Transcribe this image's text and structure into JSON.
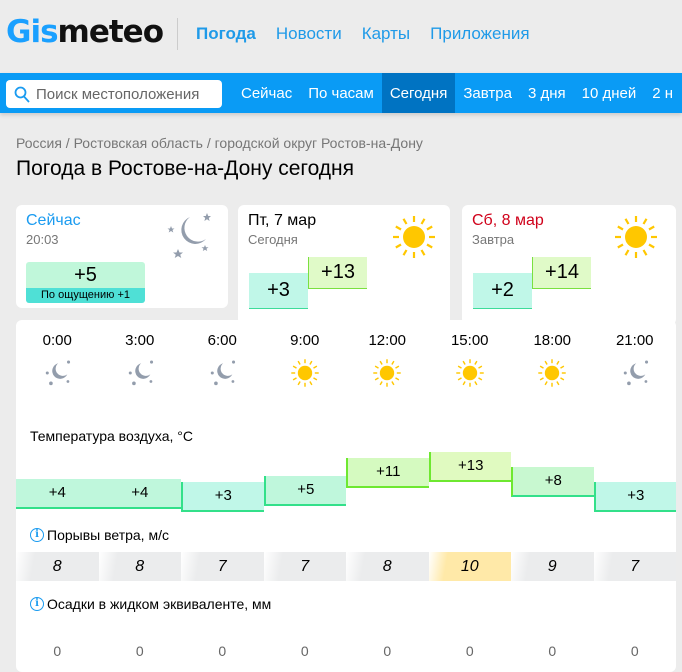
{
  "header": {
    "logo_a": "Gis",
    "logo_b": "meteo",
    "nav": [
      "Погода",
      "Новости",
      "Карты",
      "Приложения"
    ]
  },
  "search": {
    "placeholder": "Поиск местоположения"
  },
  "tabs": [
    "Сейчас",
    "По часам",
    "Сегодня",
    "Завтра",
    "3 дня",
    "10 дней",
    "2 н"
  ],
  "active_tab": 2,
  "breadcrumb": "Россия / Ростовская область / городской округ Ростов-на-Дону",
  "title": "Погода в Ростове-на-Дону сегодня",
  "now": {
    "label": "Сейчас",
    "time": "20:03",
    "temp": "+5",
    "feels": "По ощущению +1",
    "icon": "moon-stars-icon"
  },
  "today": {
    "date": "Пт, 7 мар",
    "label": "Сегодня",
    "min": "+3",
    "max": "+13",
    "icon": "sun-icon"
  },
  "tomorrow": {
    "date": "Сб, 8 мар",
    "label": "Завтра",
    "min": "+2",
    "max": "+14",
    "icon": "sun-icon"
  },
  "colors": {
    "accent": "#0a9bf5",
    "active_tab": "#0073c2",
    "weekend": "#d0021b"
  },
  "hourly": {
    "times": [
      "0:00",
      "3:00",
      "6:00",
      "9:00",
      "12:00",
      "15:00",
      "18:00",
      "21:00"
    ],
    "icons": [
      "moon",
      "moon",
      "moon",
      "sun",
      "sun",
      "sun",
      "sun",
      "moon"
    ],
    "temp_label": "Температура воздуха, °C",
    "temps": [
      "+4",
      "+4",
      "+3",
      "+5",
      "+11",
      "+13",
      "+8",
      "+3"
    ],
    "temp_values": [
      4,
      4,
      3,
      5,
      11,
      13,
      8,
      3
    ],
    "wind_label": "Порывы ветра, м/с",
    "wind": [
      "8",
      "8",
      "7",
      "7",
      "8",
      "10",
      "9",
      "7"
    ],
    "wind_max_index": 5,
    "precip_label": "Осадки в жидком эквиваленте, мм",
    "precip": [
      "0",
      "0",
      "0",
      "0",
      "0",
      "0",
      "0",
      "0"
    ]
  }
}
